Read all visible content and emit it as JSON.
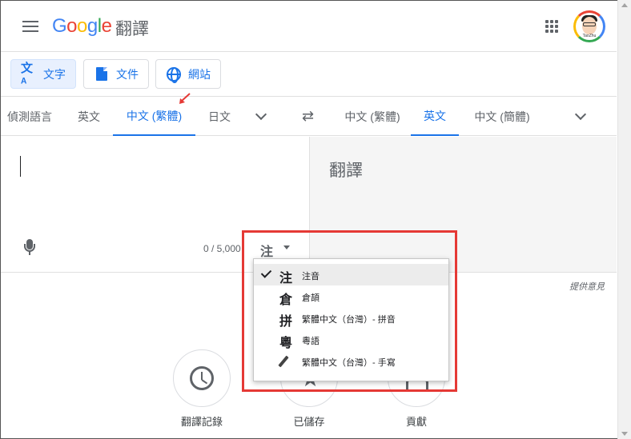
{
  "header": {
    "logo_text": "Google",
    "logo_suffix": "翻譯",
    "avatar_tag": "TaoZhu"
  },
  "modes": [
    {
      "label": "文字",
      "active": true
    },
    {
      "label": "文件",
      "active": false
    },
    {
      "label": "網站",
      "active": false
    }
  ],
  "source_langs": [
    "偵測語言",
    "英文",
    "中文 (繁體)",
    "日文"
  ],
  "target_langs": [
    "中文 (繁體)",
    "英文",
    "中文 (簡體)"
  ],
  "source_active_index": 2,
  "target_active_index": 1,
  "input": {
    "counter": "0 / 5,000",
    "ime_current": "注"
  },
  "output": {
    "placeholder": "翻譯"
  },
  "feedback": "提供意見",
  "ime_menu": [
    {
      "glyph": "注",
      "label": "注音",
      "selected": true
    },
    {
      "glyph": "倉",
      "label": "倉頡",
      "selected": false
    },
    {
      "glyph": "拼",
      "label": "繁體中文（台灣）- 拼音",
      "selected": false
    },
    {
      "glyph": "粵",
      "label": "粵語",
      "selected": false
    },
    {
      "glyph": "pencil-icon",
      "label": "繁體中文（台灣）- 手寫",
      "selected": false
    }
  ],
  "bottom": [
    {
      "label": "翻譯記錄",
      "icon": "history-icon"
    },
    {
      "label": "已儲存",
      "icon": "star-icon"
    },
    {
      "label": "貢獻",
      "icon": "contribute-icon"
    }
  ],
  "colors": {
    "accent": "#1a73e8",
    "highlight": "#e53935"
  }
}
